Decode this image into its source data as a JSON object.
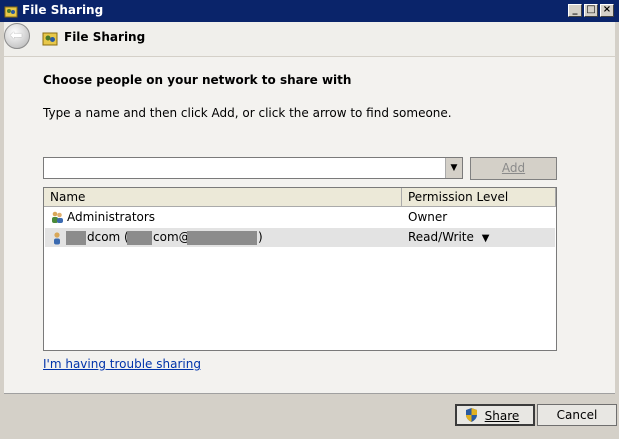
{
  "window": {
    "title": "File Sharing",
    "controls": {
      "minimize": "_",
      "maximize": "□",
      "close": "×"
    }
  },
  "header": {
    "back_icon": "back-arrow-icon",
    "title": "File Sharing"
  },
  "main": {
    "heading": "Choose people on your network to share with",
    "instruction": "Type a name and then click Add, or click the arrow to find someone.",
    "name_input": {
      "value": "",
      "placeholder": ""
    },
    "dropdown_arrow": "▼",
    "add_button": "Add",
    "columns": [
      "Name",
      "Permission Level"
    ],
    "rows": [
      {
        "name": "Administrators",
        "permission": "Owner",
        "icon": "group-icon"
      },
      {
        "name_prefix": "",
        "name_part1": "dcom (",
        "name_part2": "com@",
        "name_suffix": ")",
        "permission": "Read/Write",
        "caret": "▼",
        "icon": "user-icon"
      }
    ],
    "trouble_link": "I'm having trouble sharing"
  },
  "footer": {
    "share_button": "Share",
    "cancel_button": "Cancel"
  },
  "colors": {
    "titlebar": "#0a246a",
    "link": "#0033aa",
    "selected_row": "#e3e3e3"
  }
}
